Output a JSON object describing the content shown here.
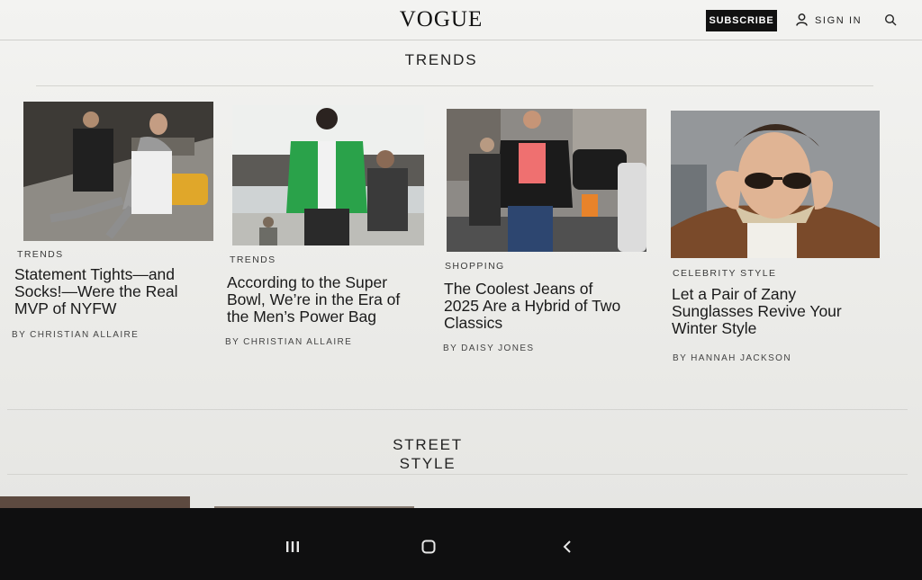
{
  "header": {
    "logo": "VOGUE",
    "subscribe_label": "SUBSCRIBE",
    "signin_label": "SIGN IN",
    "icons": [
      "user-icon",
      "search-icon"
    ]
  },
  "sections": {
    "trends_title": "TRENDS",
    "street_style_title_line1": "STREET",
    "street_style_title_line2": "STYLE"
  },
  "cards": [
    {
      "label": "TRENDS",
      "headline": [
        "Statement Tights—and",
        "Socks!—Were the Real",
        "MVP of NYFW"
      ],
      "byline": "BY CHRISTIAN ALLAIRE"
    },
    {
      "label": "TRENDS",
      "headline": [
        "According to the Super",
        "Bowl, We’re in the Era of",
        "the Men’s Power Bag"
      ],
      "byline": "BY CHRISTIAN ALLAIRE"
    },
    {
      "label": "SHOPPING",
      "headline": [
        "The Coolest Jeans of",
        "2025 Are a Hybrid of Two",
        "Classics"
      ],
      "byline": "BY DAISY JONES"
    },
    {
      "label": "CELEBRITY STYLE",
      "headline": [
        "Let a Pair of Zany",
        "Sunglasses Revive Your",
        "Winter Style"
      ],
      "byline": "BY HANNAH JACKSON"
    }
  ],
  "navbar": {
    "icons": [
      "recent-apps-icon",
      "home-icon",
      "back-icon"
    ]
  },
  "colors": {
    "accent": "#111111",
    "background": "#f1f1ef",
    "navbar": "#0f0f10"
  }
}
